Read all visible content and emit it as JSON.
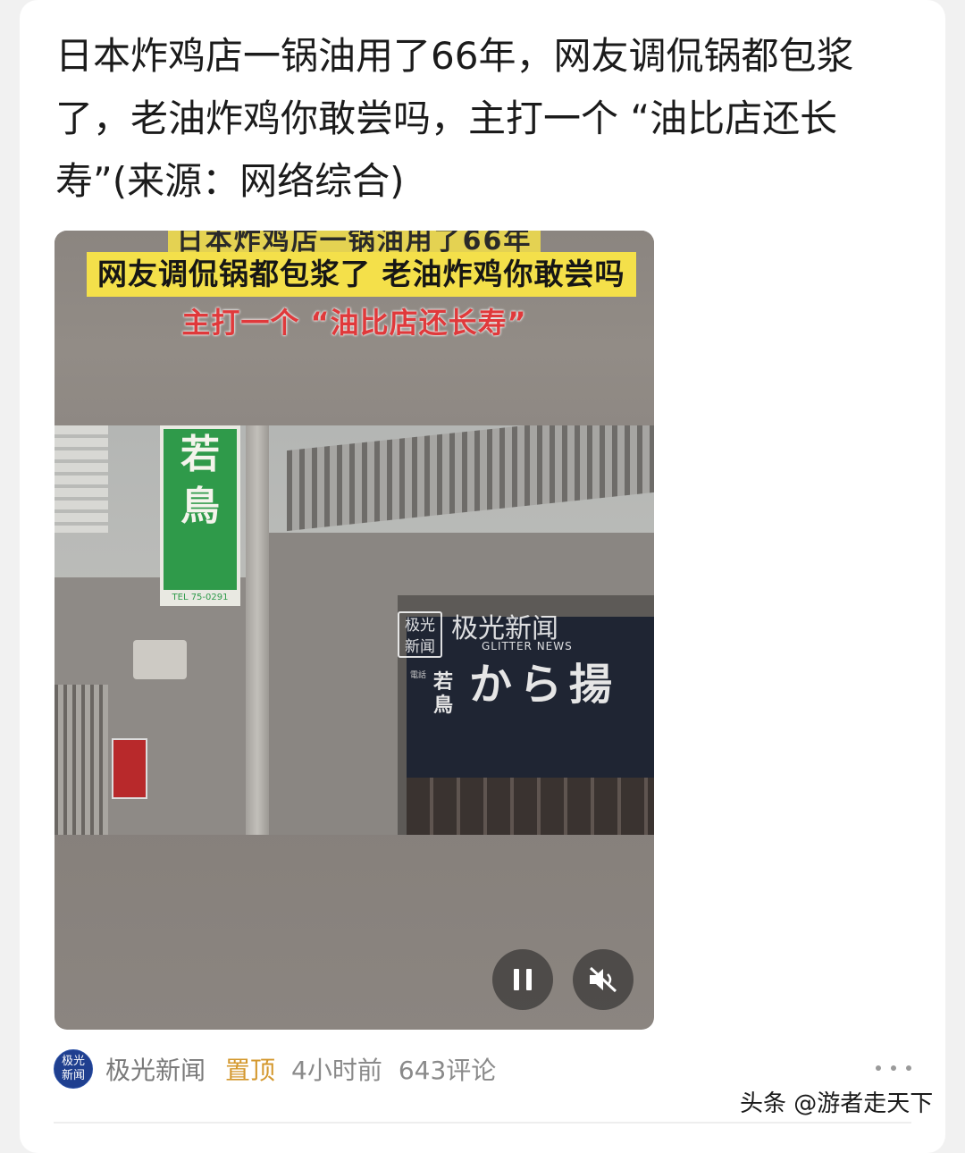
{
  "post": {
    "headline": "日本炸鸡店一锅油用了66年，网友调侃锅都包浆了，老油炸鸡你敢尝吗，主打一个 “油比店还长寿”(来源：网络综合)"
  },
  "video": {
    "caption_line1": "日本炸鸡店一锅油用了66年",
    "caption_line2": "网友调侃锅都包浆了 老油炸鸡你敢尝吗",
    "caption_line3": "主打一个 “油比店还长寿”",
    "sign_text": "若鳥",
    "sign_tel": "TEL 75-0291",
    "noren_text": "から揚",
    "noren_small_text": "若鳥",
    "watermark_logo": "极光新闻",
    "watermark_name": "极光新闻",
    "watermark_sub": "GLITTER NEWS",
    "pause_icon": "pause-icon",
    "mute_icon": "muted-speaker-icon"
  },
  "meta": {
    "avatar_text": "极光新闻",
    "source": "极光新闻",
    "pinned_label": "置顶",
    "time": "4小时前",
    "comments": "643评论",
    "more_icon": "more-dots-icon"
  },
  "watermark": {
    "text": "头条 @游者走天下"
  },
  "colors": {
    "pinned": "#d4982e",
    "caption_highlight": "#f4e04a",
    "caption_red": "#e0393b",
    "sign_green": "#2f9a4a"
  }
}
